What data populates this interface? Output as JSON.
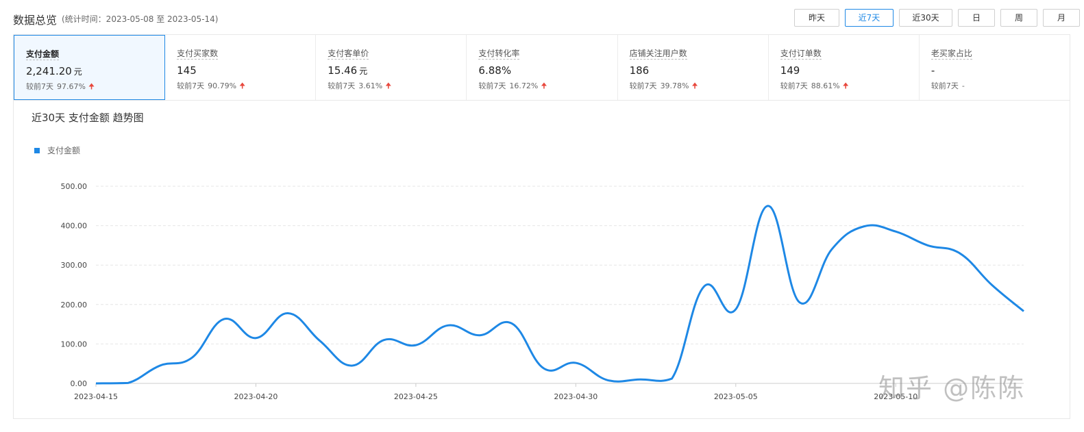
{
  "header": {
    "title": "数据总览",
    "subtitle": "(统计时间：2023-05-08 至 2023-05-14)"
  },
  "periods": [
    {
      "label": "昨天",
      "active": false
    },
    {
      "label": "近7天",
      "active": true
    },
    {
      "label": "近30天",
      "active": false
    },
    {
      "label": "日",
      "active": false
    },
    {
      "label": "周",
      "active": false
    },
    {
      "label": "月",
      "active": false
    }
  ],
  "metrics": [
    {
      "label": "支付金额",
      "value": "2,241.20",
      "unit": "元",
      "compare_label": "较前7天",
      "compare_value": "97.67%",
      "trend": "up",
      "active": true
    },
    {
      "label": "支付买家数",
      "value": "145",
      "unit": "",
      "compare_label": "较前7天",
      "compare_value": "90.79%",
      "trend": "up",
      "active": false
    },
    {
      "label": "支付客单价",
      "value": "15.46",
      "unit": "元",
      "compare_label": "较前7天",
      "compare_value": "3.61%",
      "trend": "up",
      "active": false
    },
    {
      "label": "支付转化率",
      "value": "6.88%",
      "unit": "",
      "compare_label": "较前7天",
      "compare_value": "16.72%",
      "trend": "up",
      "active": false
    },
    {
      "label": "店铺关注用户数",
      "value": "186",
      "unit": "",
      "compare_label": "较前7天",
      "compare_value": "39.78%",
      "trend": "up",
      "active": false
    },
    {
      "label": "支付订单数",
      "value": "149",
      "unit": "",
      "compare_label": "较前7天",
      "compare_value": "88.61%",
      "trend": "up",
      "active": false
    },
    {
      "label": "老买家占比",
      "value": "-",
      "unit": "",
      "compare_label": "较前7天",
      "compare_value": "-",
      "trend": "none",
      "active": false
    }
  ],
  "chart_data": {
    "type": "line",
    "title": "近30天 支付金额 趋势图",
    "series": [
      {
        "name": "支付金额",
        "color": "#1e88e5",
        "x": [
          "2023-04-15",
          "2023-04-16",
          "2023-04-17",
          "2023-04-18",
          "2023-04-19",
          "2023-04-20",
          "2023-04-21",
          "2023-04-22",
          "2023-04-23",
          "2023-04-24",
          "2023-04-25",
          "2023-04-26",
          "2023-04-27",
          "2023-04-28",
          "2023-04-29",
          "2023-04-30",
          "2023-05-01",
          "2023-05-02",
          "2023-05-03",
          "2023-05-04",
          "2023-05-05",
          "2023-05-06",
          "2023-05-07",
          "2023-05-08",
          "2023-05-09",
          "2023-05-10",
          "2023-05-11",
          "2023-05-12",
          "2023-05-13",
          "2023-05-14"
        ],
        "values": [
          0,
          1,
          45,
          65,
          163,
          115,
          178,
          108,
          45,
          110,
          97,
          147,
          122,
          152,
          38,
          52,
          8,
          10,
          12,
          245,
          188,
          450,
          205,
          340,
          398,
          385,
          350,
          330,
          250,
          183
        ]
      }
    ],
    "x_tick_labels": [
      "2023-04-15",
      "2023-04-20",
      "2023-04-25",
      "2023-04-30",
      "2023-05-05",
      "2023-05-10"
    ],
    "y_tick_labels": [
      "0.00",
      "100.00",
      "200.00",
      "300.00",
      "400.00",
      "500.00"
    ],
    "ylim": [
      0,
      500
    ],
    "grid": true,
    "legend": "top-left"
  },
  "watermark": "知乎 @陈陈"
}
